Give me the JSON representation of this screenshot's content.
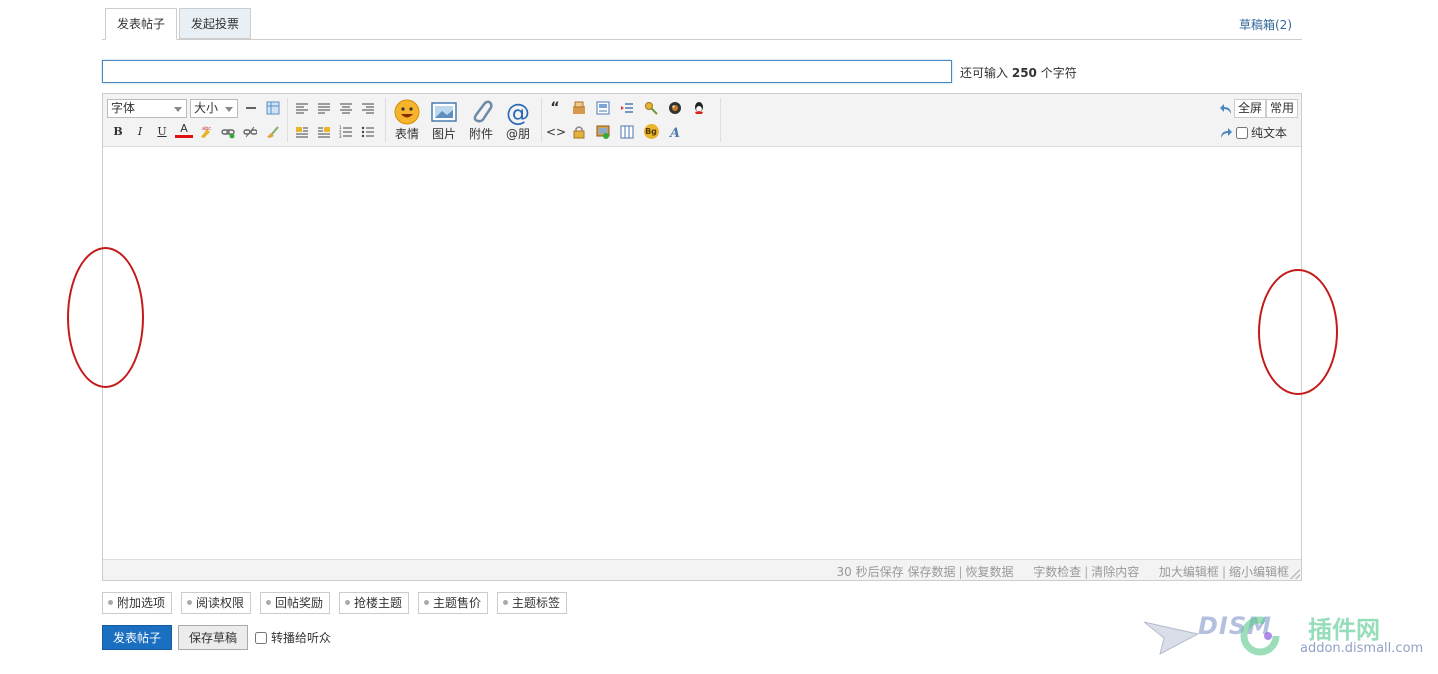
{
  "tabs": [
    {
      "label": "发表帖子",
      "active": true
    },
    {
      "label": "发起投票",
      "active": false
    }
  ],
  "drafts_link": "草稿箱(2)",
  "subject": {
    "value": "",
    "remain_prefix": "还可输入",
    "remain_count": "250",
    "remain_suffix": "个字符"
  },
  "toolbar": {
    "font_select": "字体",
    "size_select": "大小",
    "bold": "B",
    "italic": "I",
    "underline": "U",
    "font_color": "A",
    "big_buttons": [
      {
        "icon": "smiley-icon",
        "label": "表情"
      },
      {
        "icon": "image-icon",
        "label": "图片"
      },
      {
        "icon": "paperclip-icon",
        "label": "附件"
      },
      {
        "icon": "at-icon",
        "label": "@朋"
      }
    ],
    "quote_glyph": "“",
    "code_glyph": "<>",
    "bg_glyph": "Bg",
    "fullscreen_button": "全屏",
    "common_button": "常用",
    "plaintext_label": "纯文本"
  },
  "statusbar": {
    "autosave": "30 秒后保存",
    "save_data": "保存数据",
    "restore_data": "恢复数据",
    "word_check": "字数检查",
    "clear_content": "清除内容",
    "enlarge": "加大编辑框",
    "shrink": "缩小编辑框"
  },
  "options": [
    "附加选项",
    "阅读权限",
    "回帖奖励",
    "抢楼主题",
    "主题售价",
    "主题标签"
  ],
  "buttons": {
    "submit": "发表帖子",
    "save_draft": "保存草稿",
    "broadcast": "转播给听众"
  },
  "watermark": {
    "brand": "DISM",
    "brand_cn": "插件网",
    "url": "addon.dismall.com"
  },
  "colors": {
    "primary": "#1a6fc1",
    "annotation": "#c41a1a",
    "link": "#336699"
  }
}
